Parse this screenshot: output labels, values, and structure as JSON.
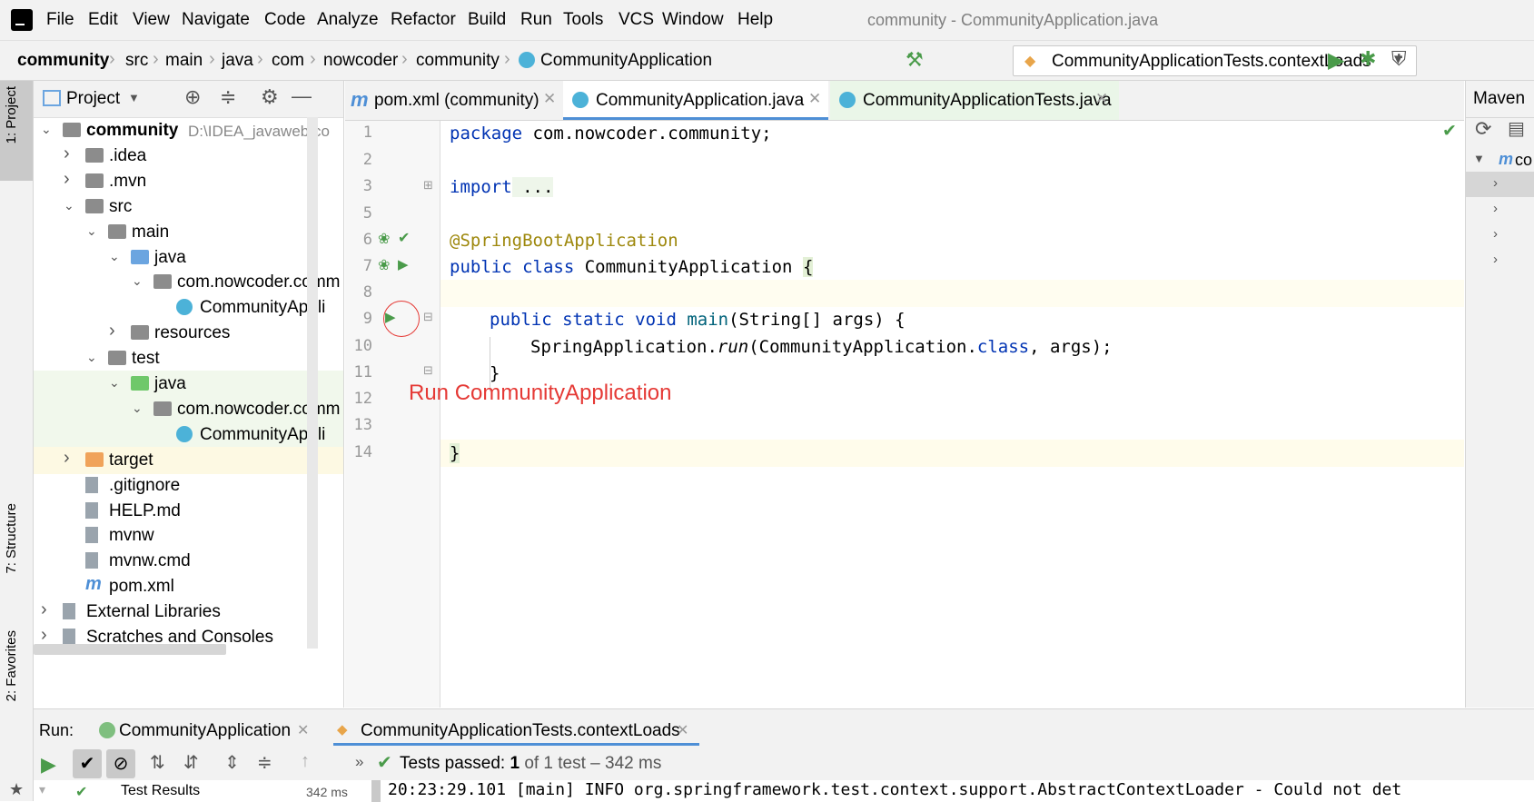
{
  "menu": [
    "File",
    "Edit",
    "View",
    "Navigate",
    "Code",
    "Analyze",
    "Refactor",
    "Build",
    "Run",
    "Tools",
    "VCS",
    "Window",
    "Help"
  ],
  "window_title": "community - CommunityApplication.java",
  "breadcrumb": [
    "community",
    "src",
    "main",
    "java",
    "com",
    "nowcoder",
    "community",
    "CommunityApplication"
  ],
  "run_config": "CommunityApplicationTests.contextLoads",
  "left_tabs": {
    "project": "1: Project",
    "structure": "7: Structure",
    "favorites": "2: Favorites"
  },
  "project_panel": {
    "title": "Project",
    "tree": [
      {
        "label": "community",
        "path": "D:\\IDEA_javaweb\\co",
        "icon": "folder",
        "indent": 0,
        "arrow": "down",
        "bold": true
      },
      {
        "label": ".idea",
        "icon": "folder",
        "indent": 1,
        "arrow": "right"
      },
      {
        "label": ".mvn",
        "icon": "folder",
        "indent": 1,
        "arrow": "right"
      },
      {
        "label": "src",
        "icon": "folder",
        "indent": 1,
        "arrow": "down"
      },
      {
        "label": "main",
        "icon": "folder",
        "indent": 2,
        "arrow": "down"
      },
      {
        "label": "java",
        "icon": "folder-blue",
        "indent": 3,
        "arrow": "down"
      },
      {
        "label": "com.nowcoder.comm",
        "icon": "package",
        "indent": 4,
        "arrow": "down"
      },
      {
        "label": "CommunityAppli",
        "icon": "class",
        "indent": 5,
        "arrow": ""
      },
      {
        "label": "resources",
        "icon": "folder",
        "indent": 3,
        "arrow": "right"
      },
      {
        "label": "test",
        "icon": "folder",
        "indent": 2,
        "arrow": "down"
      },
      {
        "label": "java",
        "icon": "folder-green",
        "indent": 3,
        "arrow": "down"
      },
      {
        "label": "com.nowcoder.comm",
        "icon": "package",
        "indent": 4,
        "arrow": "down"
      },
      {
        "label": "CommunityAppli",
        "icon": "class",
        "indent": 5,
        "arrow": ""
      },
      {
        "label": "target",
        "icon": "folder-orange",
        "indent": 1,
        "arrow": "right"
      },
      {
        "label": ".gitignore",
        "icon": "file",
        "indent": 1,
        "arrow": ""
      },
      {
        "label": "HELP.md",
        "icon": "md",
        "indent": 1,
        "arrow": ""
      },
      {
        "label": "mvnw",
        "icon": "file",
        "indent": 1,
        "arrow": ""
      },
      {
        "label": "mvnw.cmd",
        "icon": "file",
        "indent": 1,
        "arrow": ""
      },
      {
        "label": "pom.xml",
        "icon": "maven",
        "indent": 1,
        "arrow": ""
      },
      {
        "label": "External Libraries",
        "icon": "lib",
        "indent": 0,
        "arrow": "right"
      },
      {
        "label": "Scratches and Consoles",
        "icon": "scratch",
        "indent": 0,
        "arrow": "right"
      }
    ]
  },
  "editor_tabs": [
    {
      "label": "pom.xml (community)",
      "active": false
    },
    {
      "label": "CommunityApplication.java",
      "active": true
    },
    {
      "label": "CommunityApplicationTests.java",
      "active": false
    }
  ],
  "code": {
    "lines": [
      "1",
      "2",
      "3",
      "5",
      "6",
      "7",
      "8",
      "9",
      "10",
      "11",
      "12",
      "13",
      "14"
    ],
    "l1_kw": "package",
    "l1_rest": " com.nowcoder.community;",
    "l3_kw": "import",
    "l3_rest": " ...",
    "l6_ann": "@SpringBootApplication",
    "l7_kw": "public class",
    "l7_rest": " CommunityApplication ",
    "l7_brace": "{",
    "l9_kw": "public static void",
    "l9_m": " main",
    "l9_rest": "(String[] args) {",
    "l10_a": "SpringApplication.",
    "l10_run": "run",
    "l10_b": "(CommunityApplication.",
    "l10_class": "class",
    "l10_c": ", args);",
    "l11": "}",
    "l13": "}"
  },
  "tooltip": "Run CommunityApplication",
  "maven_panel": {
    "title": "Maven",
    "root": "co"
  },
  "run_panel": {
    "label": "Run:",
    "tabs": [
      "CommunityApplication",
      "CommunityApplicationTests.contextLoads"
    ],
    "status_prefix": "Tests passed:",
    "status_count": "1",
    "status_suffix": "of 1 test – 342 ms",
    "results_label": "Test Results",
    "results_time": "342 ms",
    "console_line": "20:23:29.101 [main] INFO org.springframework.test.context.support.AbstractContextLoader - Could not det"
  },
  "colors": {
    "accent": "#4e8fd6",
    "run_green": "#4a9b4a",
    "tooltip_red": "#e53935",
    "keyword": "#0033b3",
    "annotation": "#9e880d"
  }
}
